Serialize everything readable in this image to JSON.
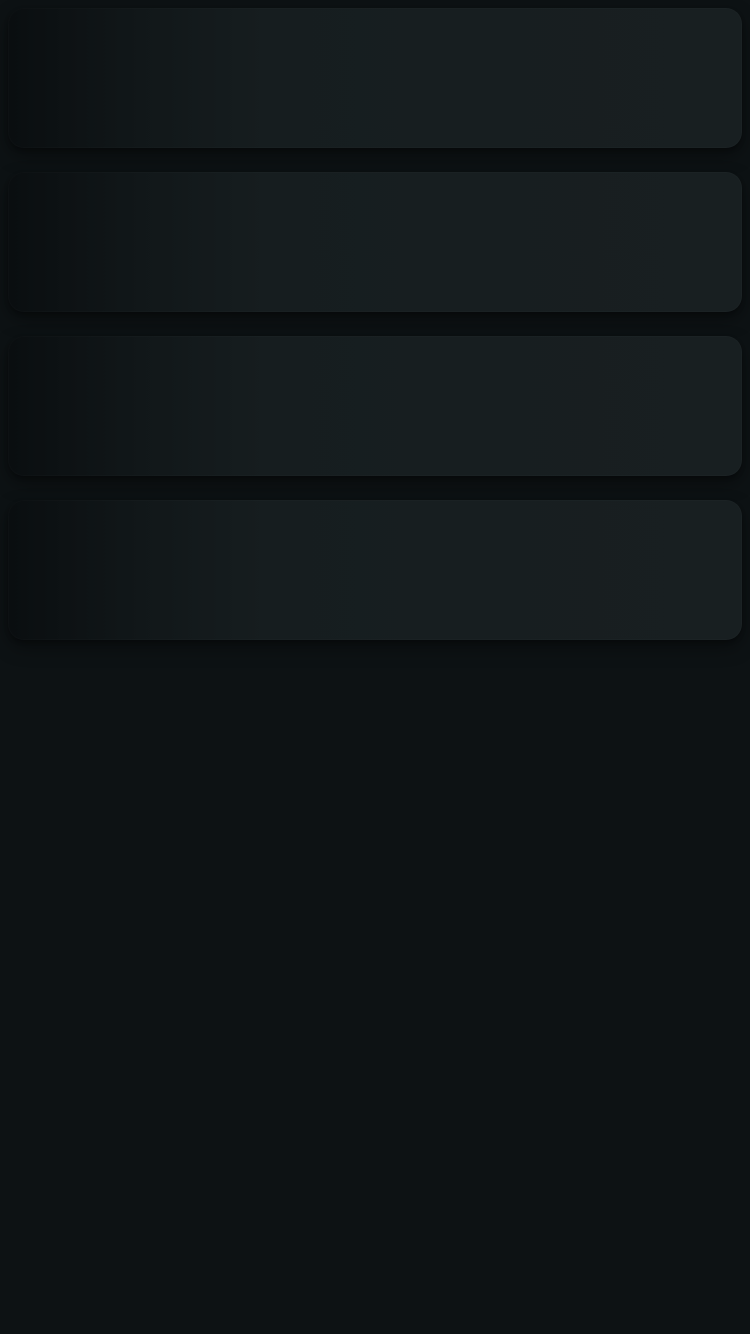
{
  "screen": {
    "state": "loading",
    "placeholder_cards": [
      {
        "id": 1
      },
      {
        "id": 2
      },
      {
        "id": 3
      },
      {
        "id": 4
      }
    ]
  },
  "colors": {
    "background": "#0d1214",
    "card_dark_edge": "#0a0e10",
    "card_surface": "#181f21"
  }
}
